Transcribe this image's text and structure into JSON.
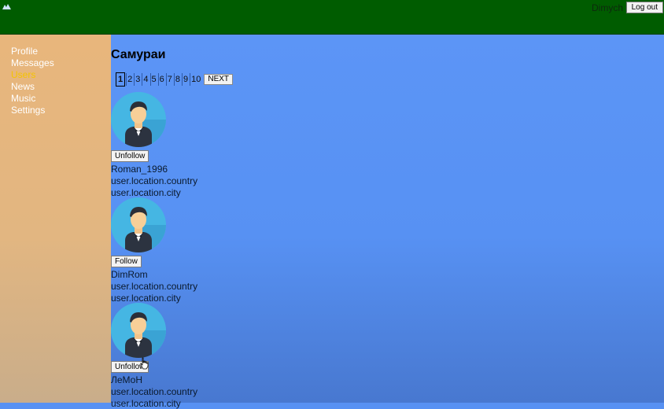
{
  "header": {
    "login_name": "Dimych",
    "logout_label": "Log out"
  },
  "sidebar": {
    "items": [
      {
        "label": "Profile"
      },
      {
        "label": "Messages"
      },
      {
        "label": "Users"
      },
      {
        "label": "News"
      },
      {
        "label": "Music"
      },
      {
        "label": "Settings"
      }
    ]
  },
  "main": {
    "title": "Самураи",
    "pages": [
      "1",
      "2",
      "3",
      "4",
      "5",
      "6",
      "7",
      "8",
      "9",
      "10"
    ],
    "next_label": "NEXT",
    "users": [
      {
        "button": "Unfollow",
        "name": "Roman_1996",
        "country": "user.location.country",
        "city": "user.location.city"
      },
      {
        "button": "Follow",
        "name": "DimRom",
        "country": "user.location.country",
        "city": "user.location.city"
      },
      {
        "button": "Unfollow",
        "name": "ЛеМоН",
        "country": "user.location.country",
        "city": "user.location.city"
      }
    ]
  },
  "colors": {
    "header_bg": "#005c00",
    "sidebar_bg": "#e8b67c",
    "main_bg": "#5791f3",
    "active_nav": "#f5c400"
  }
}
